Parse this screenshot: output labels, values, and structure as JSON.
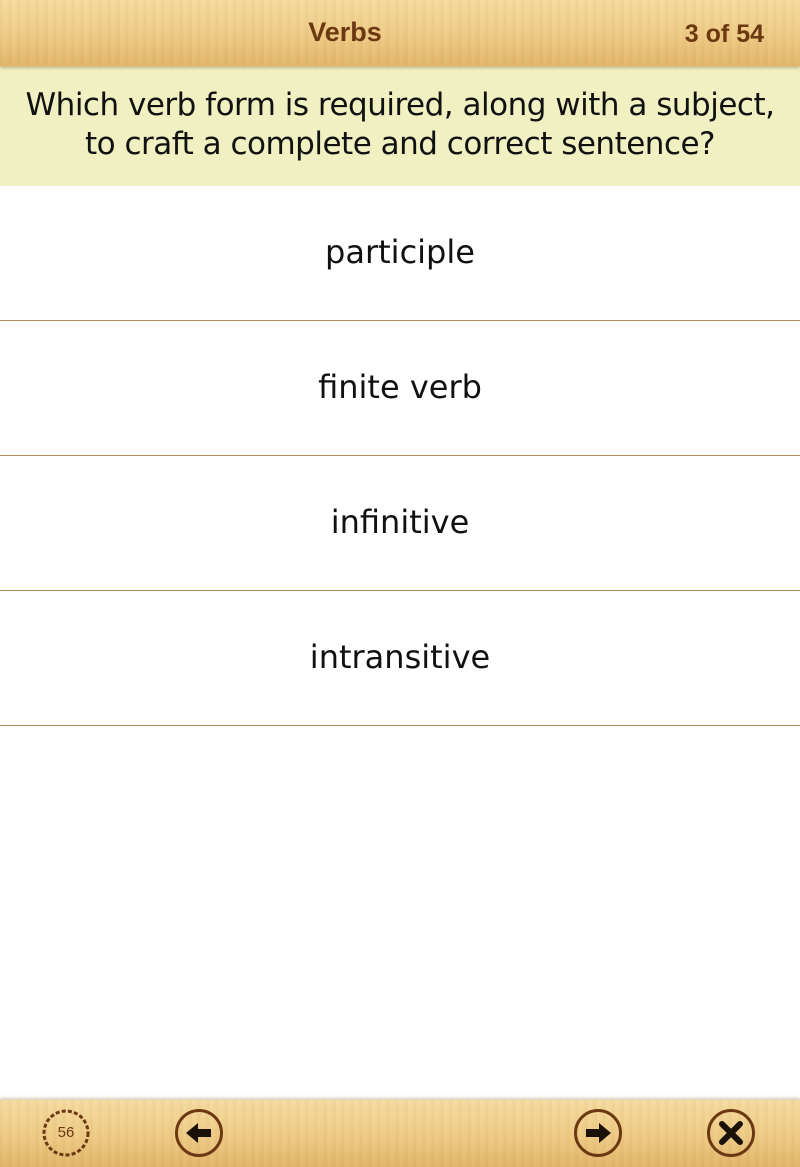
{
  "header": {
    "title": "Verbs",
    "counter": "3 of 54"
  },
  "question": {
    "text": "Which verb form is required, along with a subject, to craft a complete and correct sentence?"
  },
  "answers": [
    {
      "label": "participle"
    },
    {
      "label": "finite verb"
    },
    {
      "label": "infinitive"
    },
    {
      "label": "intransitive"
    }
  ],
  "footer": {
    "timer_value": "56",
    "timer_icon": "timer-icon",
    "back_icon": "arrow-left-icon",
    "next_icon": "arrow-right-icon",
    "close_icon": "close-icon"
  },
  "colors": {
    "wood_light": "#f6dca0",
    "wood_dark": "#e2b56a",
    "brown_text": "#6b3812",
    "question_bg": "#f0f0c2",
    "divider": "#b58a55"
  }
}
